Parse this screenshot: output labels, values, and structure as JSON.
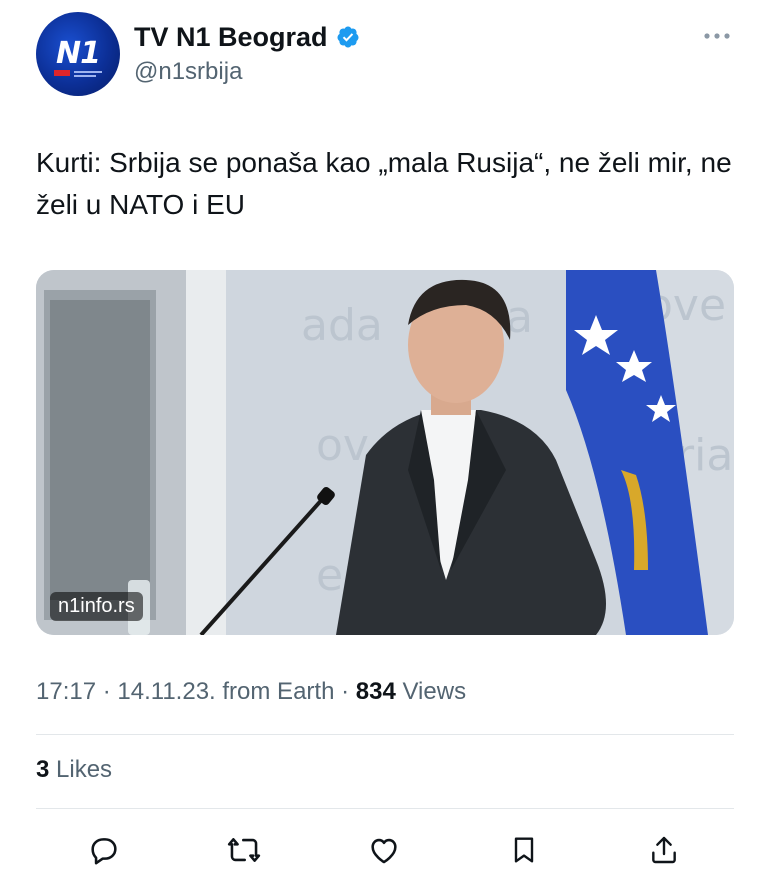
{
  "author": {
    "display_name": "TV N1 Beograd",
    "handle": "@n1srbija",
    "avatar_logo_text": "N1",
    "verified": true,
    "verified_color": "#1d9bf0"
  },
  "tweet": {
    "text": "Kurti: Srbija se ponaša kao „mala Rusija“, ne želi mir, ne želi u NATO i EU",
    "media_watermark": "n1info.rs"
  },
  "meta": {
    "time": "17:17",
    "date": "14.11.23.",
    "source": "from Earth",
    "views_count": "834",
    "views_label": "Views",
    "separator": "·"
  },
  "engagement": {
    "likes_count": "3",
    "likes_label": "Likes"
  },
  "actions": [
    {
      "name": "reply-icon"
    },
    {
      "name": "retweet-icon"
    },
    {
      "name": "like-icon"
    },
    {
      "name": "bookmark-icon"
    },
    {
      "name": "share-icon"
    }
  ],
  "colors": {
    "text_primary": "#0f1419",
    "text_secondary": "#536471",
    "brand_blue": "#0c2f96",
    "flag_blue": "#2a4fc1",
    "flag_gold": "#d8a82a"
  }
}
